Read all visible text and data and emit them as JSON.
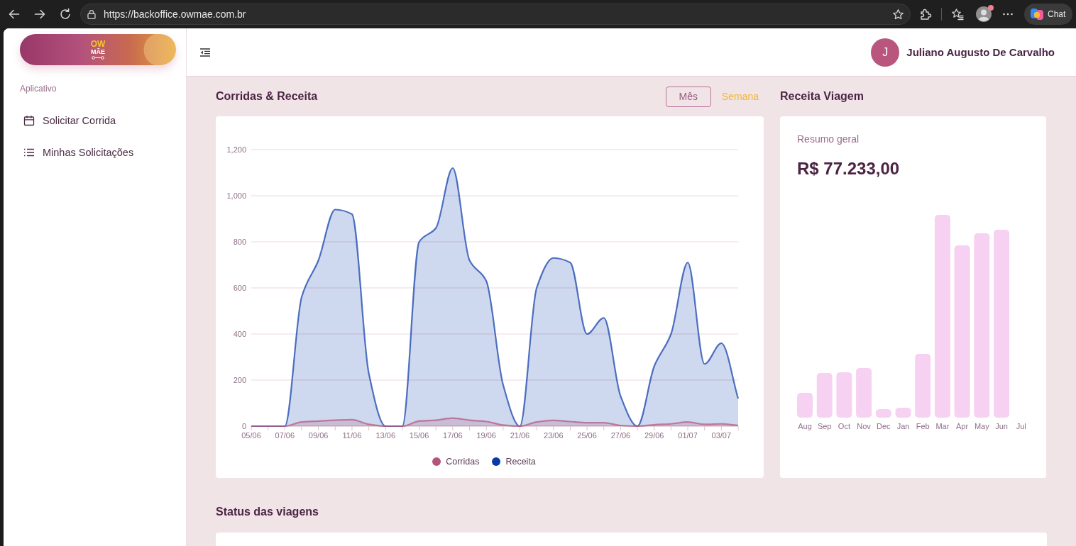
{
  "browser": {
    "url": "https://backoffice.owmae.com.br",
    "chat_button": "Chat"
  },
  "sidebar": {
    "logo": {
      "top": "OW",
      "bottom": "MÃE"
    },
    "section_label": "Aplicativo",
    "items": [
      {
        "label": "Solicitar Corrida"
      },
      {
        "label": "Minhas Solicitações"
      }
    ]
  },
  "header": {
    "avatar_initial": "J",
    "user_name": "Juliano Augusto De Carvalho"
  },
  "rides_revenue": {
    "title": "Corridas & Receita",
    "periods": [
      {
        "label": "Mês",
        "selected": true
      },
      {
        "label": "Semana",
        "selected": false
      }
    ],
    "chart_data": {
      "type": "area",
      "categories": [
        "05/06",
        null,
        "07/06",
        null,
        "09/06",
        null,
        "11/06",
        null,
        "13/06",
        null,
        "15/06",
        null,
        "17/06",
        null,
        "19/06",
        null,
        "21/06",
        null,
        "23/06",
        null,
        "25/06",
        null,
        "27/06",
        null,
        "29/06",
        null,
        "01/07",
        null,
        "03/07",
        null
      ],
      "ylim": [
        0,
        1200
      ],
      "yticks": [
        0,
        200,
        400,
        600,
        800,
        {
          "value": 1000,
          "label": "1,000"
        },
        {
          "value": 1200,
          "label": "1,200"
        }
      ],
      "grid": true,
      "legend": "bottom",
      "series": [
        {
          "name": "Corridas",
          "color": "#b5547a",
          "values": [
            0,
            0,
            0,
            18,
            22,
            26,
            28,
            8,
            0,
            0,
            22,
            26,
            35,
            26,
            20,
            5,
            0,
            18,
            25,
            20,
            15,
            15,
            3,
            0,
            6,
            10,
            18,
            8,
            10,
            3
          ]
        },
        {
          "name": "Receita",
          "color": "#0b3aa8",
          "values": [
            0,
            0,
            0,
            560,
            720,
            940,
            920,
            230,
            0,
            0,
            800,
            860,
            1120,
            720,
            630,
            180,
            0,
            600,
            730,
            710,
            400,
            470,
            130,
            0,
            260,
            400,
            710,
            270,
            360,
            120
          ]
        }
      ]
    }
  },
  "trip_revenue": {
    "title": "Receita Viagem",
    "subtitle": "Resumo geral",
    "total": "R$ 77.233,00",
    "month_labels": [
      "Aug",
      "Sep",
      "Oct",
      "Nov",
      "Dec",
      "Jan",
      "Feb",
      "Mar",
      "Apr",
      "May",
      "Jun",
      "Jul"
    ]
  },
  "trip_status": {
    "title": "Status das viagens"
  }
}
